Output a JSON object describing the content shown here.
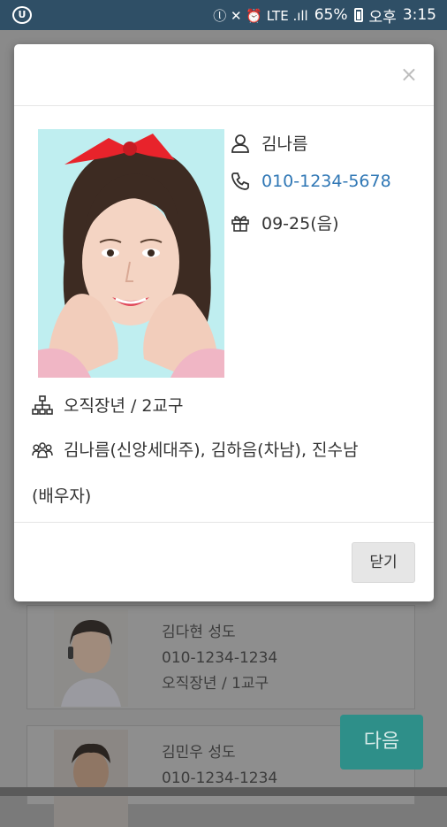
{
  "status_bar": {
    "app_icon": "U",
    "indicators": "ⓛ ✕ ⏰ LTE .ıll",
    "battery": "65%",
    "ampm": "오후",
    "time": "3:15"
  },
  "modal": {
    "close_symbol": "×",
    "name": "김나름",
    "phone": "010-1234-5678",
    "birthday": "09-25(음)",
    "group": "오직장년 / 2교구",
    "family_line1": "김나름(신앙세대주), 김하음(차남), 진수남",
    "family_line2": "(배우자)",
    "close_button": "닫기"
  },
  "background": {
    "cards": [
      {
        "name": "김다현 성도",
        "phone": "010-1234-1234",
        "group": "오직장년 / 1교구"
      },
      {
        "name": "김민우 성도",
        "phone": "010-1234-1234",
        "group": ""
      }
    ],
    "next_button": "다음"
  },
  "icons": {
    "person": "person-icon",
    "phone": "phone-icon",
    "gift": "gift-icon",
    "org": "org-chart-icon",
    "family": "family-icon"
  },
  "colors": {
    "status_bar": "#2f4f66",
    "phone_link": "#2f77b5",
    "next_button": "#2e8f89"
  }
}
